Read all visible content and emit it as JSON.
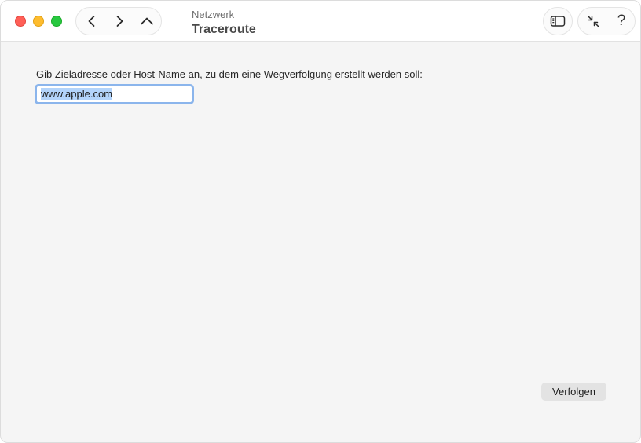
{
  "window": {
    "subtitle": "Netzwerk",
    "title": "Traceroute"
  },
  "toolbar": {
    "back_icon": "chevron-left-icon",
    "forward_icon": "chevron-right-icon",
    "up_icon": "chevron-up-icon",
    "sidebar_icon": "sidebar-icon",
    "shrink_icon": "shrink-arrows-icon",
    "help_label": "?"
  },
  "form": {
    "prompt": "Gib Zieladresse oder Host-Name an, zu dem eine Wegverfolgung erstellt werden soll:",
    "host_value": "www.apple.com",
    "submit_label": "Verfolgen"
  },
  "colors": {
    "close": "#ff5f57",
    "minimize": "#febc2e",
    "zoom": "#28c840",
    "focus_ring": "#8bb5ec",
    "selection": "#b3d4fb"
  }
}
